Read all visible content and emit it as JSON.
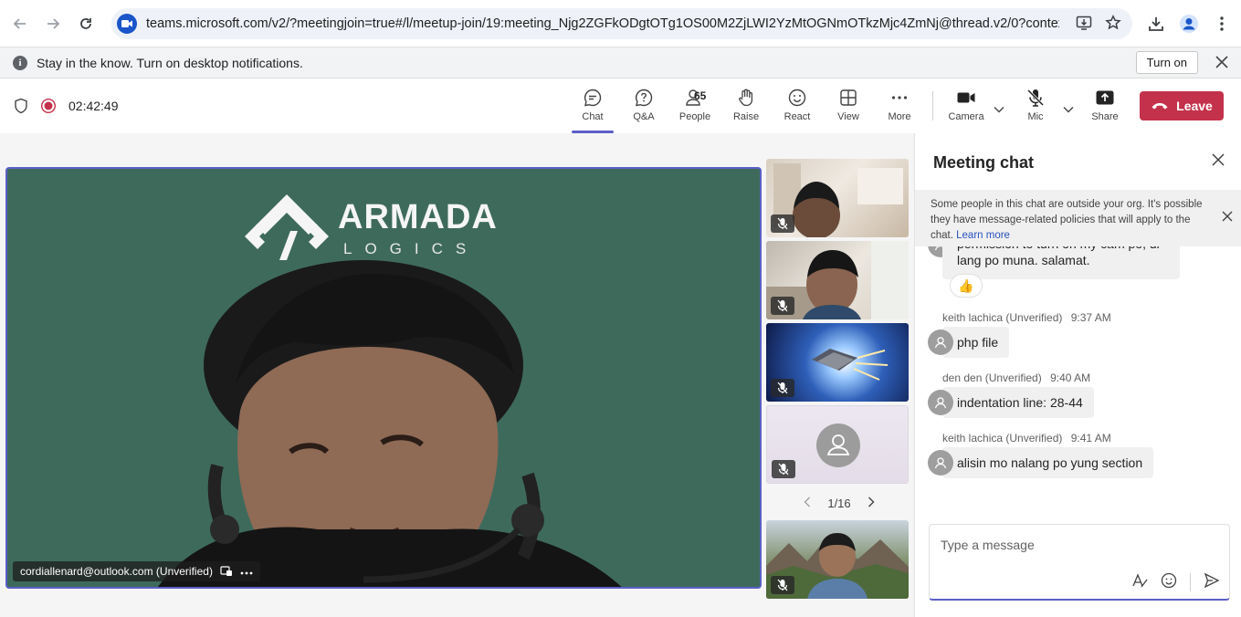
{
  "browser": {
    "url": "teams.microsoft.com/v2/?meetingjoin=true#/l/meetup-join/19:meeting_Njg2ZGFkODgtOTg1OS00M2ZjLWI2YzMtOGNmOTkzMjc4ZmNj@thread.v2/0?context=%...",
    "icons": [
      "back-icon",
      "forward-icon",
      "reload-icon",
      "install-icon",
      "star-icon",
      "download-icon",
      "profile-icon",
      "menu-icon"
    ]
  },
  "notification": {
    "text": "Stay in the know. Turn on desktop notifications.",
    "button": "Turn on"
  },
  "toolbar": {
    "timer": "02:42:49",
    "chat": "Chat",
    "qa": "Q&A",
    "people": "People",
    "people_count": "65",
    "raise": "Raise",
    "react": "React",
    "view": "View",
    "more": "More",
    "camera": "Camera",
    "mic": "Mic",
    "share": "Share",
    "leave": "Leave"
  },
  "stage": {
    "logo_word": "ARMADA",
    "logo_sub": "LOGICS",
    "speaker_name": "cordiallenard@outlook.com (Unverified)",
    "pager": "1/16"
  },
  "chat": {
    "title": "Meeting chat",
    "banner_text": "Some people in this chat are outside your org. It's possible they have message-related policies that will apply to the chat.",
    "banner_link": "Learn more",
    "partial_message_line1": "permission to turn on my cam po, di",
    "partial_message_line2": "lang po muna. salamat.",
    "reaction": "👍",
    "messages": [
      {
        "sender": "keith lachica (Unverified)",
        "time": "9:37 AM",
        "text": "php file"
      },
      {
        "sender": "den den (Unverified)",
        "time": "9:40 AM",
        "text": "indentation line: 28-44"
      },
      {
        "sender": "keith lachica (Unverified)",
        "time": "9:41 AM",
        "text": "alisin mo nalang po yung section"
      }
    ],
    "compose_placeholder": "Type a message"
  },
  "colors": {
    "accent": "#5b5fc7",
    "leave": "#c4314b",
    "stage_bg": "#3e6a5c"
  }
}
